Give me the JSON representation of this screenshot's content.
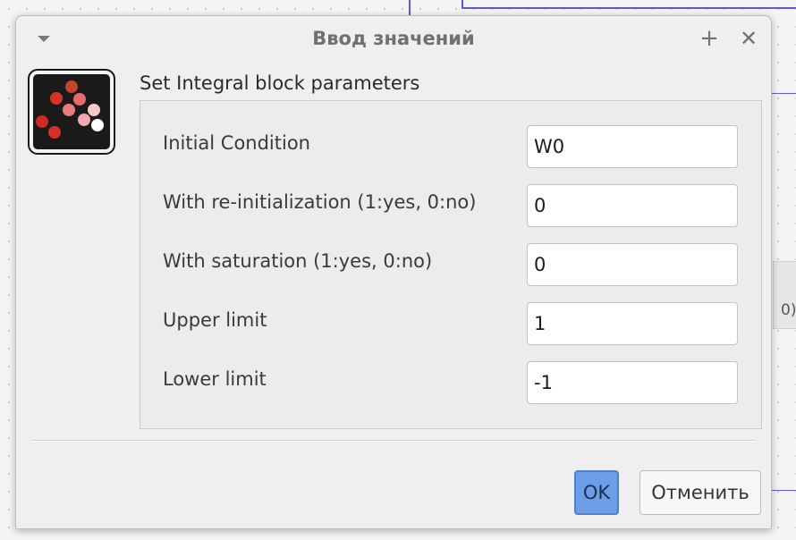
{
  "background": {
    "partial_block_text": "0)"
  },
  "dialog": {
    "title": "Ввод значений",
    "menu_icon": "chevron-down-icon",
    "maximize_icon": "plus-icon",
    "close_icon": "close-icon",
    "app_icon": "scilab-xcos-icon",
    "heading": "Set Integral block parameters",
    "fields": [
      {
        "label": "Initial Condition",
        "value": "W0"
      },
      {
        "label": "With re-initialization (1:yes, 0:no)",
        "value": "0"
      },
      {
        "label": "With saturation (1:yes, 0:no)",
        "value": "0"
      },
      {
        "label": "Upper limit",
        "value": "1"
      },
      {
        "label": "Lower limit",
        "value": "-1"
      }
    ],
    "buttons": {
      "ok": "OK",
      "cancel": "Отменить"
    }
  },
  "colors": {
    "ok_button": "#6b9ee6",
    "wire": "#5b5bd6"
  }
}
